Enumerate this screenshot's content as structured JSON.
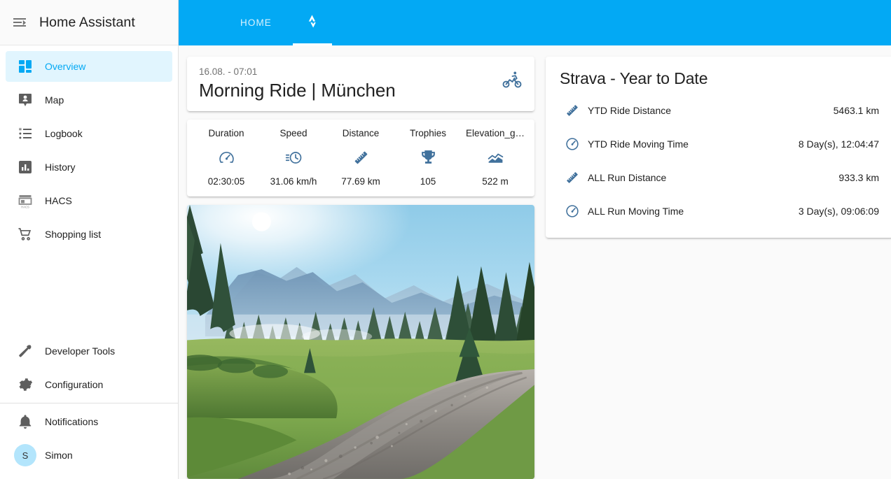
{
  "sidebar": {
    "menu_icon": "menu-open-icon",
    "title": "Home Assistant",
    "items": [
      {
        "label": "Overview",
        "icon": "view-dashboard-icon",
        "active": true
      },
      {
        "label": "Map",
        "icon": "map-marker-account-icon",
        "active": false
      },
      {
        "label": "Logbook",
        "icon": "format-list-bulleted-icon",
        "active": false
      },
      {
        "label": "History",
        "icon": "chart-box-icon",
        "active": false
      },
      {
        "label": "HACS",
        "icon": "hacs-storefront-icon",
        "active": false
      },
      {
        "label": "Shopping list",
        "icon": "cart-icon",
        "active": false
      }
    ],
    "bottom_items": [
      {
        "label": "Developer Tools",
        "icon": "hammer-icon"
      },
      {
        "label": "Configuration",
        "icon": "gear-icon"
      }
    ],
    "footer_items": [
      {
        "label": "Notifications",
        "icon": "bell-icon"
      }
    ],
    "user": {
      "label": "Simon",
      "initial": "S"
    }
  },
  "topbar": {
    "accent_color": "#03a9f4",
    "tabs": [
      {
        "label": "HOME",
        "icon": null,
        "active": false
      },
      {
        "label": "",
        "icon": "strava-logo-icon",
        "active": true
      }
    ]
  },
  "ride": {
    "date": "16.08. - 07:01",
    "title": "Morning Ride | München",
    "icon": "bike-icon",
    "icon_color": "#41719c",
    "stats": [
      {
        "label": "Duration",
        "icon": "gauge-icon",
        "value": "02:30:05"
      },
      {
        "label": "Speed",
        "icon": "clock-fast-icon",
        "value": "31.06 km/h"
      },
      {
        "label": "Distance",
        "icon": "ruler-icon",
        "value": "77.69 km"
      },
      {
        "label": "Trophies",
        "icon": "trophy-icon",
        "value": "105"
      },
      {
        "label": "Elevation_g…",
        "icon": "elevation-rise-icon",
        "value": "522 m"
      }
    ],
    "photo_alt": "Alpine meadow with gravel path, forest and mountains at sunrise"
  },
  "strava": {
    "title": "Strava - Year to Date",
    "rows": [
      {
        "icon": "ruler-icon",
        "name": "YTD Ride Distance",
        "value": "5463.1 km"
      },
      {
        "icon": "gauge-icon",
        "name": "YTD Ride Moving Time",
        "value": "8 Day(s), 12:04:47"
      },
      {
        "icon": "ruler-icon",
        "name": "ALL Run Distance",
        "value": "933.3 km"
      },
      {
        "icon": "gauge-icon",
        "name": "ALL Run Moving Time",
        "value": "3 Day(s), 09:06:09"
      }
    ]
  }
}
